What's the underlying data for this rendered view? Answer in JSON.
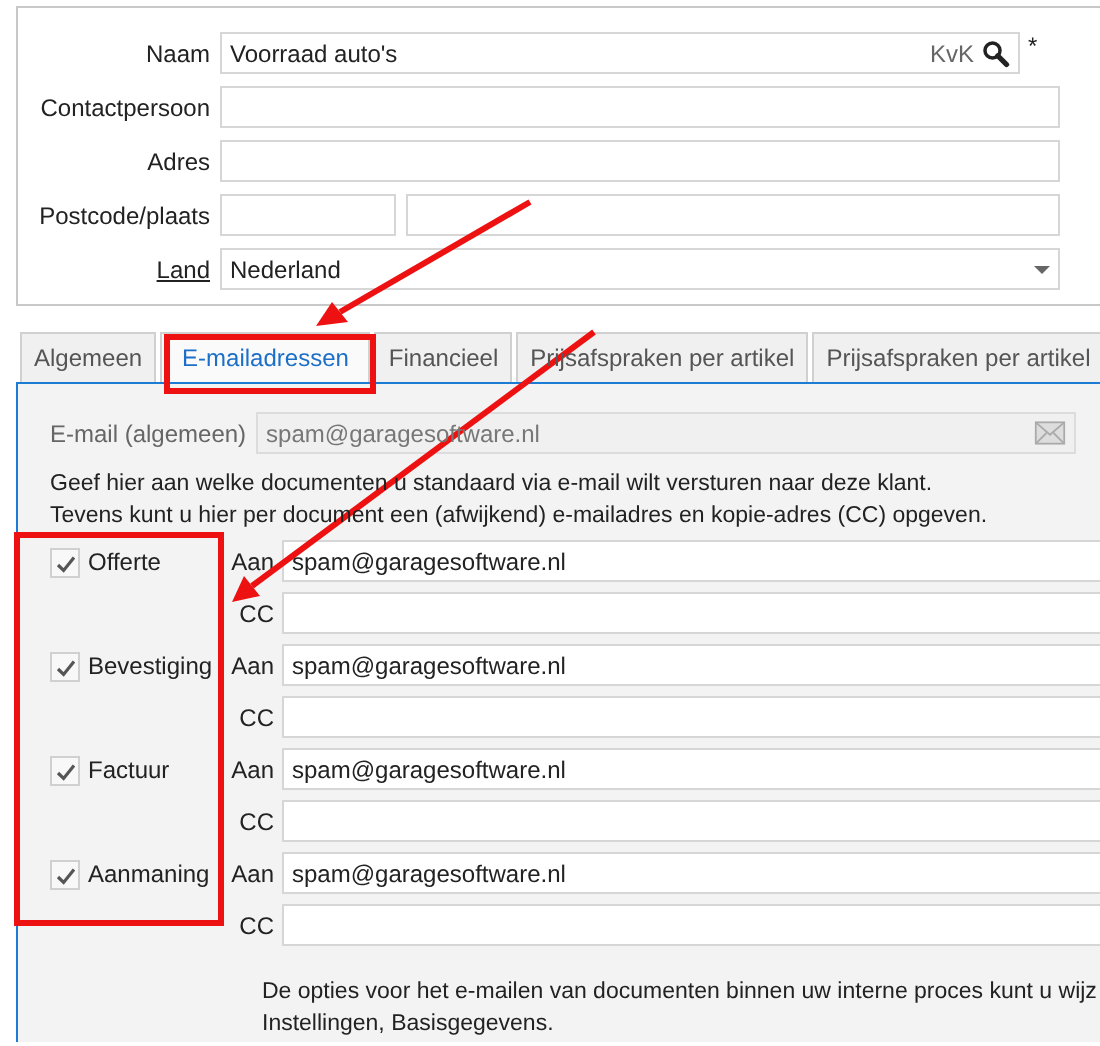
{
  "record": {
    "fields": [
      {
        "label": "Naam",
        "kind": "search",
        "value": "Voorraad auto's",
        "suffix": "KvK",
        "required_mark": "*"
      },
      {
        "label": "Contactpersoon",
        "kind": "text"
      },
      {
        "label": "Adres",
        "kind": "text"
      },
      {
        "label": "Postcode/plaats",
        "kind": "split"
      },
      {
        "label": "Land",
        "kind": "select",
        "value": "Nederland",
        "underlined": true
      }
    ]
  },
  "tabs": [
    {
      "label": "Algemeen",
      "selected": false
    },
    {
      "label": "E-mailadressen",
      "selected": true
    },
    {
      "label": "Financieel",
      "selected": false
    },
    {
      "label": "Prijsafspraken per artikel",
      "selected": false
    },
    {
      "label": "Prijsafspraken per artikel",
      "selected": false
    }
  ],
  "email_panel": {
    "general_label": "E-mail (algemeen)",
    "general_value": "spam@garagesoftware.nl",
    "general_disabled": true,
    "intro": [
      "Geef hier aan welke documenten u standaard via e-mail wilt versturen naar deze klant.",
      "Tevens kunt u hier per document een (afwijkend) e-mailadres en kopie-adres (CC) opgeven."
    ],
    "documents": [
      {
        "label": "Offerte",
        "checked": true,
        "to_label": "Aan",
        "to_value": "spam@garagesoftware.nl",
        "cc_label": "CC"
      },
      {
        "label": "Bevestiging",
        "checked": true,
        "to_label": "Aan",
        "to_value": "spam@garagesoftware.nl",
        "cc_label": "CC"
      },
      {
        "label": "Factuur",
        "checked": true,
        "to_label": "Aan",
        "to_value": "spam@garagesoftware.nl",
        "cc_label": "CC"
      },
      {
        "label": "Aanmaning",
        "checked": true,
        "to_label": "Aan",
        "to_value": "spam@garagesoftware.nl",
        "cc_label": "CC"
      }
    ],
    "footer": [
      "De opties voor het e-mailen van documenten binnen uw interne proces kunt u wijz",
      "Instellingen, Basisgegevens."
    ]
  }
}
